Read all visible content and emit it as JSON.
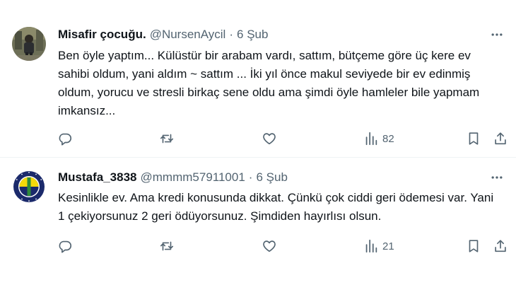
{
  "tweets": [
    {
      "display_name": "Misafir çocuğu.",
      "handle": "@NursenAycil",
      "separator": "·",
      "time": "6 Şub",
      "text": "Ben öyle yaptım... Külüstür bir arabam vardı, sattım, bütçeme göre üç kere ev sahibi oldum, yani aldım ~ sattım ... İki yıl önce makul seviyede bir ev edinmiş oldum, yorucu ve stresli birkaç sene oldu ama şimdi öyle hamleler bile yapmam imkansız...",
      "views": "82"
    },
    {
      "display_name": "Mustafa_3838",
      "handle": "@mmmm57911001",
      "separator": "·",
      "time": "6 Şub",
      "text": "Kesinlikle ev. Ama kredi konusunda dikkat. Çünkü çok ciddi geri ödemesi var. Yani 1 çekiyorsunuz 2 geri ödüyorsunuz. Şimdiden hayırlısı olsun.",
      "views": "21"
    }
  ],
  "colors": {
    "text": "#0f1419",
    "secondary": "#536471",
    "divider": "#eff3f4",
    "fenerbahce_navy": "#1b2a6b",
    "fenerbahce_yellow": "#f5d90a"
  }
}
